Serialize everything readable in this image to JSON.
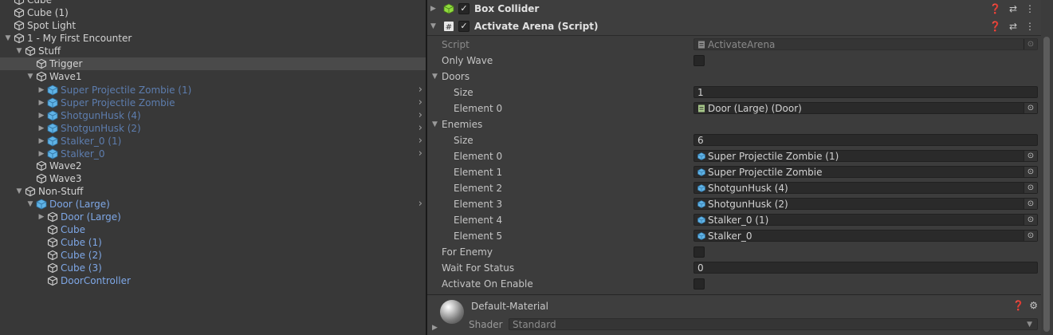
{
  "hierarchy": {
    "items": [
      {
        "label": "Cube",
        "color": "white"
      },
      {
        "label": "Cube (1)",
        "color": "white"
      },
      {
        "label": "Spot Light",
        "color": "white"
      },
      {
        "label": "1 - My First Encounter",
        "color": "white"
      },
      {
        "label": "Stuff",
        "color": "white"
      },
      {
        "label": "Trigger",
        "color": "white"
      },
      {
        "label": "Wave1",
        "color": "white"
      },
      {
        "label": "Super Projectile Zombie (1)",
        "color": "dimblue"
      },
      {
        "label": "Super Projectile Zombie",
        "color": "dimblue"
      },
      {
        "label": "ShotgunHusk (4)",
        "color": "dimblue"
      },
      {
        "label": "ShotgunHusk (2)",
        "color": "dimblue"
      },
      {
        "label": "Stalker_0 (1)",
        "color": "dimblue"
      },
      {
        "label": "Stalker_0",
        "color": "dimblue"
      },
      {
        "label": "Wave2",
        "color": "white"
      },
      {
        "label": "Wave3",
        "color": "white"
      },
      {
        "label": "Non-Stuff",
        "color": "white"
      },
      {
        "label": "Door (Large)",
        "color": "blue"
      },
      {
        "label": "Door (Large)",
        "color": "blue"
      },
      {
        "label": "Cube",
        "color": "blue"
      },
      {
        "label": "Cube (1)",
        "color": "blue"
      },
      {
        "label": "Cube (2)",
        "color": "blue"
      },
      {
        "label": "Cube (3)",
        "color": "blue"
      },
      {
        "label": "DoorController",
        "color": "blue"
      }
    ],
    "arrow_glyph": "›"
  },
  "inspector": {
    "box_collider": {
      "title": "Box Collider",
      "icon": "box-collider-icon"
    },
    "activate_arena": {
      "title": "Activate Arena (Script)",
      "icon": "script-hash-icon",
      "script_label": "Script",
      "script_value": "ActivateArena",
      "only_wave_label": "Only Wave",
      "doors_label": "Doors",
      "doors_size_label": "Size",
      "doors_size_value": "1",
      "doors_element0_label": "Element 0",
      "doors_element0_value": "Door (Large) (Door)",
      "enemies_label": "Enemies",
      "enemies_size_label": "Size",
      "enemies_size_value": "6",
      "enemies": [
        {
          "label": "Element 0",
          "value": "Super Projectile Zombie (1)"
        },
        {
          "label": "Element 1",
          "value": "Super Projectile Zombie"
        },
        {
          "label": "Element 2",
          "value": "ShotgunHusk (4)"
        },
        {
          "label": "Element 3",
          "value": "ShotgunHusk (2)"
        },
        {
          "label": "Element 4",
          "value": "Stalker_0 (1)"
        },
        {
          "label": "Element 5",
          "value": "Stalker_0"
        }
      ],
      "for_enemy_label": "For Enemy",
      "wait_for_status_label": "Wait For Status",
      "wait_for_status_value": "0",
      "activate_on_enable_label": "Activate On Enable"
    },
    "material": {
      "name": "Default-Material",
      "shader_label": "Shader",
      "shader_value": "Standard"
    }
  },
  "colors": {
    "accent": "#7ea7e6",
    "dim_prefab": "#5d7dae",
    "icon_prefab": "#5fb3e6",
    "icon_green": "#8fdb3e"
  }
}
